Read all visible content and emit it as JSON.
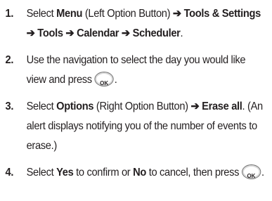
{
  "steps": [
    {
      "number": "1.",
      "t1": "Select ",
      "b1": "Menu",
      "t2": " (Left Option Button) ",
      "b2": "➔ Tools & Settings ➔ Tools ➔ Calendar ➔ Scheduler",
      "t3": "."
    },
    {
      "number": "2.",
      "t1": "Use the navigation to select the day you would like view and press",
      "button": "OK",
      "t2": "."
    },
    {
      "number": "3.",
      "t1": "Select ",
      "b1": "Options",
      "t2": " (Right Option Button) ",
      "b2": "➔ Erase all",
      "t3": ". (An alert displays notifying you of the number of events to erase.)"
    },
    {
      "number": "4.",
      "t1": "Select ",
      "b1": "Yes",
      "t2": " to confirm or ",
      "b2": "No",
      "t3": " to cancel, then press",
      "button": "OK",
      "t4": "."
    }
  ],
  "icons": {
    "ok_button": "ok-key-icon"
  }
}
